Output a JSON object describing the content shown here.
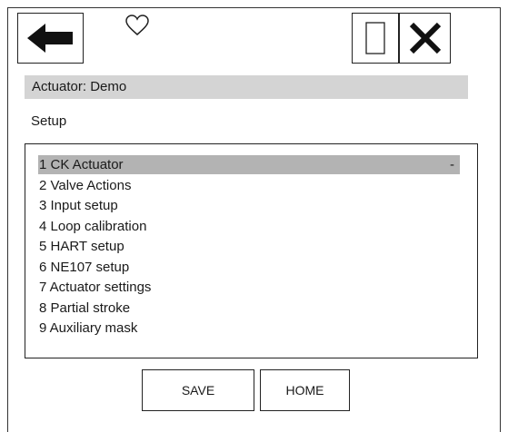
{
  "header": {
    "title": "Actuator: Demo",
    "section": "Setup"
  },
  "icons": {
    "back": "arrow-left-icon",
    "favorite": "heart-outline-icon",
    "window": "square-outline-icon",
    "close": "close-icon"
  },
  "menu": {
    "items": [
      {
        "label": "1 CK Actuator",
        "suffix": "-"
      },
      {
        "label": "2 Valve Actions"
      },
      {
        "label": "3 Input setup"
      },
      {
        "label": "4 Loop calibration"
      },
      {
        "label": "5 HART setup"
      },
      {
        "label": "6 NE107 setup"
      },
      {
        "label": "7 Actuator settings"
      },
      {
        "label": "8 Partial stroke"
      },
      {
        "label": "9 Auxiliary mask"
      }
    ],
    "selected_index": 0
  },
  "footer": {
    "save_label": "SAVE",
    "home_label": "HOME"
  },
  "colors": {
    "title_bar": "#d4d4d4",
    "selected_row": "#b3b3b3"
  }
}
